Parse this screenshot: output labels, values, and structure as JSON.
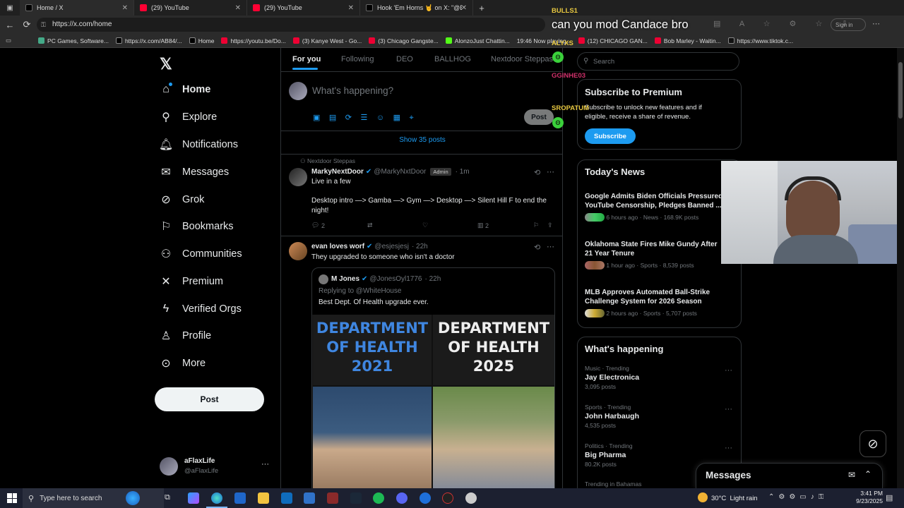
{
  "browser": {
    "tabs": [
      {
        "title": "Home / X",
        "icon": "x-logo-icon",
        "color": "#000000"
      },
      {
        "title": "(29) YouTube",
        "icon": "youtube-icon",
        "color": "#ff0033"
      },
      {
        "title": "(29) YouTube",
        "icon": "youtube-icon",
        "color": "#ff0033"
      },
      {
        "title": "Hook 'Em Horns 🤘 on X: \"@Brick",
        "icon": "x-logo-icon",
        "color": "#000000"
      }
    ],
    "new_tab": "+",
    "url": "https://x.com/home",
    "signin": "Sign in",
    "bookmarks": [
      "PC Games, Software...",
      "https://x.com/AB84/...",
      "Home",
      "https://youtu.be/Do...",
      "(3) Kanye West - Go...",
      "(3) Chicago Gangste...",
      "AlonzoJust Chattin...",
      "19:46 Now playing...",
      "(12) CHICAGO GAN...",
      "Bob Marley - Waitin...",
      "https://www.tiktok.c..."
    ]
  },
  "nav": {
    "items": [
      {
        "label": "Home",
        "icon": "home-icon"
      },
      {
        "label": "Explore",
        "icon": "search-icon"
      },
      {
        "label": "Notifications",
        "icon": "bell-icon"
      },
      {
        "label": "Messages",
        "icon": "envelope-icon"
      },
      {
        "label": "Grok",
        "icon": "grok-icon"
      },
      {
        "label": "Bookmarks",
        "icon": "bookmark-icon"
      },
      {
        "label": "Communities",
        "icon": "people-icon"
      },
      {
        "label": "Premium",
        "icon": "x-logo-icon"
      },
      {
        "label": "Verified Orgs",
        "icon": "lightning-icon"
      },
      {
        "label": "Profile",
        "icon": "person-icon"
      },
      {
        "label": "More",
        "icon": "more-circle-icon"
      }
    ],
    "post_button": "Post",
    "account_name": "aFlaxLife",
    "account_handle": "@aFlaxLife",
    "account_more": "···"
  },
  "feed": {
    "tabs": [
      "For you",
      "Following",
      "DEO",
      "BALLHOG",
      "Nextdoor Steppas"
    ],
    "compose_placeholder": "What's happening?",
    "compose_post": "Post",
    "show_posts": "Show 35 posts",
    "tweet1": {
      "community": "Nextdoor Steppas",
      "name": "MarkyNextDoor",
      "handle": "@MarkyNxtDoor",
      "badge": "Admin",
      "time": "· 1m",
      "line1": "Live in a few",
      "line2": "Desktop intro —> Gamba —> Gym —> Desktop —> Silent Hill F to end the night!",
      "replies": "2",
      "views": "2"
    },
    "tweet2": {
      "name": "evan loves worf",
      "handle": "@esjesjesj",
      "time": "· 22h",
      "text": "They upgraded to someone who isn't a doctor",
      "quote_name": "M Jones",
      "quote_handle": "@JonesOyl1776",
      "quote_time": "· 22h",
      "quote_reply": "Replying to @WhiteHouse",
      "quote_text": "Best Dept. Of Health upgrade ever.",
      "img_left": "DEPARTMENT OF HEALTH 2021",
      "img_right": "DEPARTMENT OF HEALTH 2025"
    }
  },
  "right": {
    "search_placeholder": "Search",
    "premium_title": "Subscribe to Premium",
    "premium_text": "Subscribe to unlock new features and if eligible, receive a share of revenue.",
    "premium_button": "Subscribe",
    "news_title": "Today's News",
    "news": [
      {
        "title": "Google Admits Biden Officials Pressured YouTube Censorship, Pledges Banned ...",
        "meta": "6 hours ago · News · 168.9K posts"
      },
      {
        "title": "Oklahoma State Fires Mike Gundy After 21 Year Tenure",
        "meta": "1 hour ago · Sports · 8,539 posts"
      },
      {
        "title": "MLB Approves Automated Ball-Strike Challenge System for 2026 Season",
        "meta": "2 hours ago · Sports · 5,707 posts"
      }
    ],
    "happening_title": "What's happening",
    "trends": [
      {
        "cat": "Music · Trending",
        "name": "Jay Electronica",
        "count": "3,095 posts"
      },
      {
        "cat": "Sports · Trending",
        "name": "John Harbaugh",
        "count": "4,535 posts"
      },
      {
        "cat": "Politics · Trending",
        "name": "Big Pharma",
        "count": "80.2K posts"
      },
      {
        "cat": "Trending in Bahamas",
        "name": "",
        "count": ""
      }
    ],
    "messages_title": "Messages"
  },
  "overlay": {
    "chat": [
      {
        "user": "BULLS1",
        "color": "#e8c840"
      },
      {
        "user": "ALYXS",
        "color": "#e8c840"
      },
      {
        "user": "GGINHE03",
        "color": "#d0306a"
      },
      {
        "user": "SROPATUM",
        "color": "#e8c840"
      }
    ],
    "message": "can you mod Candace bro"
  },
  "taskbar": {
    "search_placeholder": "Type here to search",
    "weather": "30°C  Light rain",
    "time": "3:41 PM",
    "date": "9/23/2025"
  }
}
